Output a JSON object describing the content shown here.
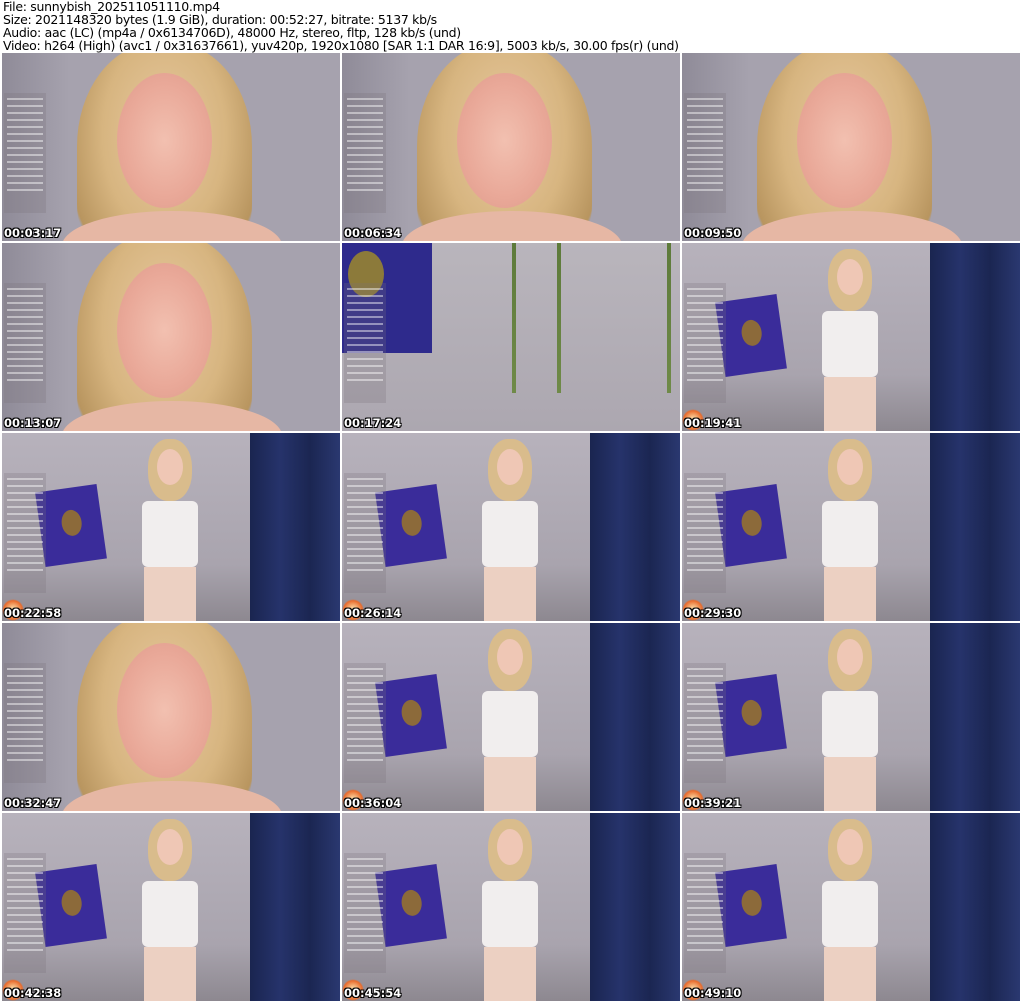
{
  "header": {
    "file": "File: sunnybish_202511051110.mp4",
    "size": "Size: 2021148320 bytes (1.9 GiB), duration: 00:52:27, bitrate: 5137 kb/s",
    "audio": "Audio: aac (LC) (mp4a / 0x6134706D), 48000 Hz, stereo, fltp, 128 kb/s (und)",
    "video": "Video: h264 (High) (avc1 / 0x31637661), yuv420p, 1920x1080 [SAR 1:1 DAR 16:9], 5003 kb/s, 30.00 fps(r) (und)"
  },
  "frames": [
    {
      "timestamp": "00:03:17",
      "scene": "close"
    },
    {
      "timestamp": "00:06:34",
      "scene": "close"
    },
    {
      "timestamp": "00:09:50",
      "scene": "close"
    },
    {
      "timestamp": "00:13:07",
      "scene": "close"
    },
    {
      "timestamp": "00:17:24",
      "scene": "wide"
    },
    {
      "timestamp": "00:19:41",
      "scene": "room"
    },
    {
      "timestamp": "00:22:58",
      "scene": "room"
    },
    {
      "timestamp": "00:26:14",
      "scene": "room"
    },
    {
      "timestamp": "00:29:30",
      "scene": "room"
    },
    {
      "timestamp": "00:32:47",
      "scene": "close"
    },
    {
      "timestamp": "00:36:04",
      "scene": "room"
    },
    {
      "timestamp": "00:39:21",
      "scene": "room"
    },
    {
      "timestamp": "00:42:38",
      "scene": "room"
    },
    {
      "timestamp": "00:45:54",
      "scene": "room"
    },
    {
      "timestamp": "00:49:10",
      "scene": "room"
    }
  ]
}
